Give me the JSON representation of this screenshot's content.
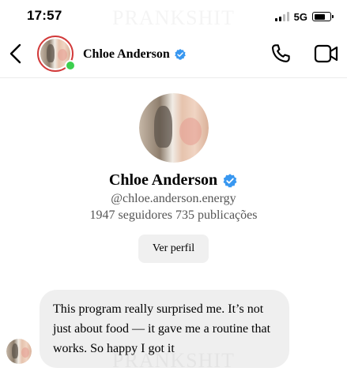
{
  "status_bar": {
    "time": "17:57",
    "network": "5G",
    "battery_level": 0.7
  },
  "watermark": "PRANKSHIT",
  "header": {
    "back_icon": "chevron-left-icon",
    "name": "Chloe Anderson",
    "verified_icon": "verified-badge-icon",
    "online": true,
    "call_icon": "phone-icon",
    "video_icon": "video-camera-icon"
  },
  "profile": {
    "name": "Chloe Anderson",
    "handle": "@chloe.anderson.energy",
    "stats": "1947 seguidores 735 publicações",
    "view_profile_label": "Ver perfil"
  },
  "messages": [
    {
      "sender": "Chloe Anderson",
      "text": "This program really surprised me. It’s not just about food — it gave me a routine that works. So happy I got it"
    }
  ],
  "colors": {
    "verified_blue": "#3897f0",
    "online_green": "#3ccf4e",
    "story_ring": "#d23a3a",
    "bubble_bg": "#efefef",
    "button_bg": "#f0f0f0"
  }
}
